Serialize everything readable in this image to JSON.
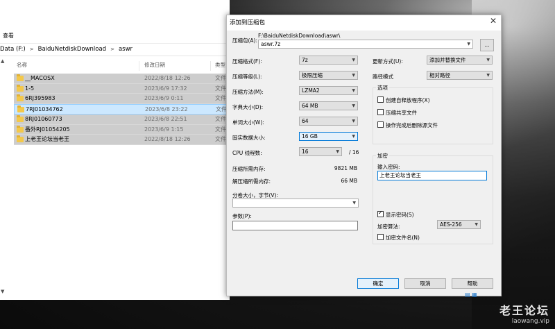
{
  "explorer": {
    "toolbar_label": "查看",
    "breadcrumbs": [
      "Data (F:)",
      "BaiduNetdiskDownload",
      "aswr"
    ],
    "breadcrumb_sep": ">",
    "columns": {
      "name": "名称",
      "date": "修改日期",
      "type": "类型"
    },
    "files": [
      {
        "name": "__MACOSX",
        "date": "2022/8/18 12:26",
        "type": "文件"
      },
      {
        "name": "1-5",
        "date": "2023/6/9 17:32",
        "type": "文件"
      },
      {
        "name": "6RJ395983",
        "date": "2023/6/9 0:11",
        "type": "文件"
      },
      {
        "name": "7RJ01034762",
        "date": "2023/6/8 23:22",
        "type": "文件",
        "selected": true
      },
      {
        "name": "8RJ01060773",
        "date": "2023/6/8 22:51",
        "type": "文件"
      },
      {
        "name": "番外RJ01054205",
        "date": "2023/6/9 1:15",
        "type": "文件"
      },
      {
        "name": "上老王论坛当老王",
        "date": "2022/8/18 12:26",
        "type": "文件"
      }
    ]
  },
  "dialog": {
    "title": "添加到压缩包",
    "close": "✕",
    "archive_label": "压缩包(A):",
    "archive_path": "F:\\BaiduNetdiskDownload\\aswr\\",
    "archive_name": "aswr.7z",
    "browse_button": "...",
    "format_label": "压缩格式(F):",
    "format_value": "7z",
    "level_label": "压缩等级(L):",
    "level_value": "极限压缩",
    "method_label": "压缩方法(M):",
    "method_value": "LZMA2",
    "dict_label": "字典大小(D):",
    "dict_value": "64 MB",
    "word_label": "单词大小(W):",
    "word_value": "64",
    "solid_label": "固实数据大小:",
    "solid_value": "16 GB",
    "cpu_label": "CPU 线程数:",
    "cpu_value": "16",
    "cpu_total": "/ 16",
    "mem_compress_label": "压缩所需内存:",
    "mem_compress_value": "9821 MB",
    "mem_decompress_label": "解压缩所需内存:",
    "mem_decompress_value": "66 MB",
    "split_label": "分卷大小，字节(V):",
    "split_value": "",
    "params_label": "参数(P):",
    "params_value": "",
    "update_label": "更新方式(U):",
    "update_value": "添加并替换文件",
    "path_label": "路径模式",
    "path_value": "相对路径",
    "options_legend": "选项",
    "opt_sfx": "创建自释放程序(X)",
    "opt_shared": "压缩共享文件",
    "opt_delete": "操作完成后删除源文件",
    "encrypt_legend": "加密",
    "password_label": "输入密码:",
    "password_value": "上老王论坛当老王",
    "show_password": "显示密码(S)",
    "enc_method_label": "加密算法:",
    "enc_method_value": "AES-256",
    "encrypt_names": "加密文件名(N)",
    "ok_button": "确定",
    "cancel_button": "取消",
    "help_button": "帮助"
  },
  "watermark": {
    "title": "老王论坛",
    "url": "laowang.vip"
  }
}
